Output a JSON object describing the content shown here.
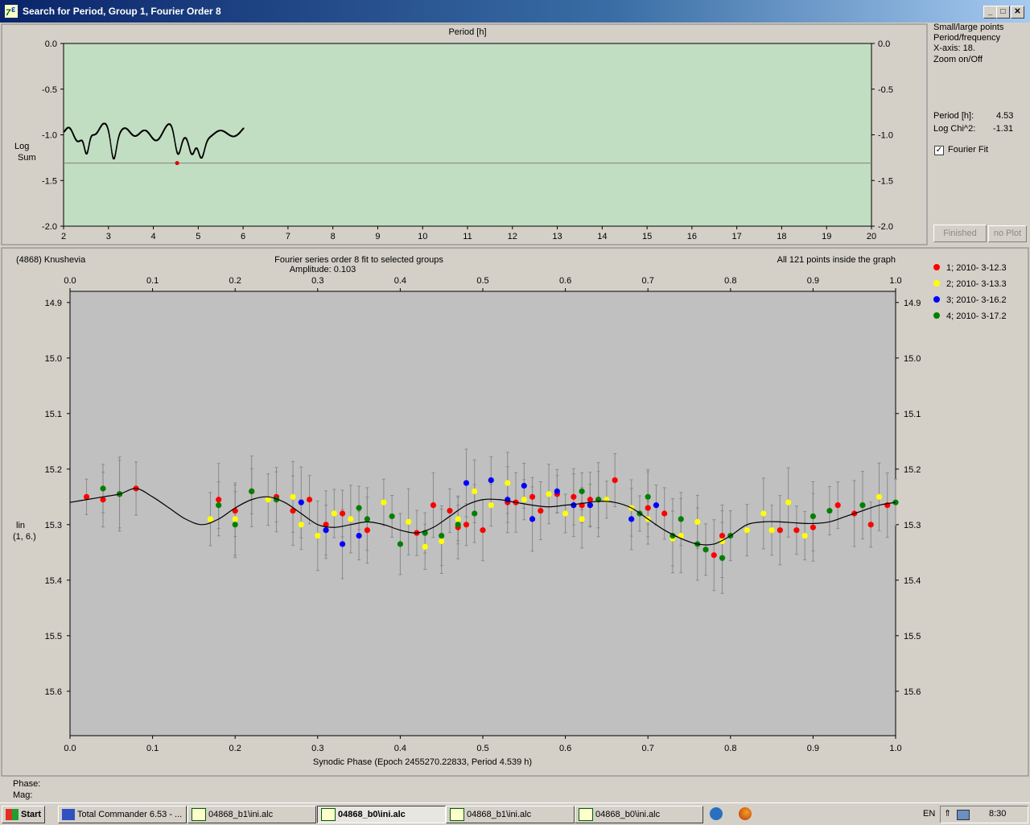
{
  "window": {
    "title": "Search for Period, Group 1, Fourier Order 8",
    "minimize_label": "_",
    "maximize_label": "□",
    "close_label": "✕"
  },
  "right_panel": {
    "options": [
      "Small/large points",
      "Period/frequency",
      "X-axis: 18.",
      "Zoom on/Off"
    ],
    "period_label": "Period [h]:",
    "period_value": "4.53",
    "logchi_label": "Log Chi^2:",
    "logchi_value": "-1.31",
    "fourier_fit_label": "Fourier Fit",
    "fourier_fit_checked": true,
    "finished_label": "Finished",
    "noplot_label": "no Plot"
  },
  "period_chart": {
    "title": "Period [h]",
    "ylabel_line1": "Log",
    "ylabel_line2": "Sum",
    "xticks": [
      "2",
      "3",
      "4",
      "5",
      "6",
      "7",
      "8",
      "9",
      "10",
      "11",
      "12",
      "13",
      "14",
      "15",
      "16",
      "17",
      "18",
      "19",
      "20"
    ],
    "yticks": [
      "0.0",
      "-0.5",
      "-1.0",
      "-1.5",
      "-2.0"
    ],
    "colors": {
      "background": "#c2dec2",
      "points": "#000000",
      "selected": "#e00000"
    }
  },
  "lightcurve_chart": {
    "object_name": "(4868) Knushevia",
    "title": "Fourier series order 8 fit to selected groups",
    "amplitude": "Amplitude: 0.103",
    "points_info": "All 121 points inside the graph",
    "ylabel_line1": "lin",
    "ylabel_line2": "(1, 6.)",
    "xlabel": "Synodic Phase (Epoch 2455270.22833, Period 4.539 h)",
    "xticks": [
      "0.0",
      "0.1",
      "0.2",
      "0.3",
      "0.4",
      "0.5",
      "0.6",
      "0.7",
      "0.8",
      "0.9",
      "1.0"
    ],
    "yticks": [
      "14.9",
      "15.0",
      "15.1",
      "15.2",
      "15.3",
      "15.4",
      "15.5",
      "15.6"
    ],
    "legend": [
      {
        "label": "1; 2010- 3-12.3",
        "color": "#ff0000"
      },
      {
        "label": "2; 2010- 3-13.3",
        "color": "#ffff00"
      },
      {
        "label": "3; 2010- 3-16.2",
        "color": "#0000ff"
      },
      {
        "label": "4; 2010- 3-17.2",
        "color": "#008000"
      }
    ]
  },
  "chart_data": [
    {
      "type": "scatter",
      "title": "Period [h]",
      "xlabel": "Period [h]",
      "ylabel": "Log Sum",
      "xlim": [
        2,
        20
      ],
      "ylim": [
        -2.0,
        0.0
      ],
      "minimum_marked": {
        "x": 4.53,
        "y": -1.31
      },
      "threshold_line": -1.31
    },
    {
      "type": "scatter",
      "title": "Fourier series order 8 fit to selected groups",
      "xlabel": "Synodic Phase (Epoch 2455270.22833, Period 4.539 h)",
      "ylabel": "lin (1, 6.)",
      "xlim": [
        0.0,
        1.0
      ],
      "ylim": [
        14.9,
        15.68
      ],
      "y_inverted": true,
      "fit_curve": {
        "x": [
          0.0,
          0.02,
          0.04,
          0.06,
          0.08,
          0.1,
          0.12,
          0.14,
          0.16,
          0.18,
          0.2,
          0.22,
          0.24,
          0.26,
          0.28,
          0.3,
          0.32,
          0.34,
          0.36,
          0.38,
          0.4,
          0.42,
          0.44,
          0.46,
          0.48,
          0.5,
          0.52,
          0.54,
          0.56,
          0.58,
          0.6,
          0.62,
          0.64,
          0.66,
          0.68,
          0.7,
          0.72,
          0.74,
          0.76,
          0.78,
          0.8,
          0.82,
          0.84,
          0.86,
          0.88,
          0.9,
          0.92,
          0.94,
          0.96,
          0.98,
          1.0
        ],
        "y": [
          15.26,
          15.255,
          15.25,
          15.245,
          15.235,
          15.25,
          15.27,
          15.29,
          15.3,
          15.29,
          15.27,
          15.255,
          15.25,
          15.26,
          15.28,
          15.3,
          15.305,
          15.3,
          15.295,
          15.3,
          15.31,
          15.315,
          15.305,
          15.285,
          15.265,
          15.255,
          15.255,
          15.26,
          15.265,
          15.268,
          15.265,
          15.262,
          15.258,
          15.26,
          15.27,
          15.29,
          15.31,
          15.325,
          15.335,
          15.335,
          15.32,
          15.3,
          15.295,
          15.295,
          15.297,
          15.298,
          15.295,
          15.285,
          15.275,
          15.265,
          15.26
        ]
      },
      "series": [
        {
          "name": "1; 2010- 3-12.3",
          "points": [
            [
              0.02,
              15.25
            ],
            [
              0.04,
              15.255
            ],
            [
              0.06,
              15.245
            ],
            [
              0.08,
              15.235
            ],
            [
              0.18,
              15.255
            ],
            [
              0.2,
              15.275
            ],
            [
              0.22,
              15.24
            ],
            [
              0.25,
              15.25
            ],
            [
              0.27,
              15.275
            ],
            [
              0.29,
              15.255
            ],
            [
              0.31,
              15.3
            ],
            [
              0.33,
              15.28
            ],
            [
              0.36,
              15.31
            ],
            [
              0.42,
              15.315
            ],
            [
              0.44,
              15.265
            ],
            [
              0.46,
              15.275
            ],
            [
              0.47,
              15.305
            ],
            [
              0.48,
              15.3
            ],
            [
              0.5,
              15.31
            ],
            [
              0.53,
              15.26
            ],
            [
              0.54,
              15.26
            ],
            [
              0.56,
              15.25
            ],
            [
              0.57,
              15.275
            ],
            [
              0.59,
              15.245
            ],
            [
              0.61,
              15.25
            ],
            [
              0.62,
              15.265
            ],
            [
              0.63,
              15.255
            ],
            [
              0.64,
              15.255
            ],
            [
              0.66,
              15.22
            ],
            [
              0.7,
              15.27
            ],
            [
              0.72,
              15.28
            ],
            [
              0.78,
              15.355
            ],
            [
              0.79,
              15.32
            ],
            [
              0.86,
              15.31
            ],
            [
              0.88,
              15.31
            ],
            [
              0.9,
              15.305
            ],
            [
              0.93,
              15.265
            ],
            [
              0.95,
              15.28
            ],
            [
              0.97,
              15.3
            ],
            [
              0.99,
              15.265
            ]
          ]
        },
        {
          "name": "2; 2010- 3-13.3",
          "points": [
            [
              0.17,
              15.29
            ],
            [
              0.2,
              15.29
            ],
            [
              0.24,
              15.255
            ],
            [
              0.27,
              15.25
            ],
            [
              0.28,
              15.3
            ],
            [
              0.3,
              15.32
            ],
            [
              0.32,
              15.28
            ],
            [
              0.34,
              15.29
            ],
            [
              0.38,
              15.26
            ],
            [
              0.41,
              15.295
            ],
            [
              0.43,
              15.34
            ],
            [
              0.45,
              15.33
            ],
            [
              0.47,
              15.29
            ],
            [
              0.49,
              15.24
            ],
            [
              0.51,
              15.265
            ],
            [
              0.53,
              15.225
            ],
            [
              0.55,
              15.255
            ],
            [
              0.58,
              15.245
            ],
            [
              0.6,
              15.28
            ],
            [
              0.62,
              15.29
            ],
            [
              0.65,
              15.255
            ],
            [
              0.68,
              15.27
            ],
            [
              0.7,
              15.29
            ],
            [
              0.73,
              15.325
            ],
            [
              0.74,
              15.32
            ],
            [
              0.76,
              15.295
            ],
            [
              0.79,
              15.33
            ],
            [
              0.82,
              15.31
            ],
            [
              0.84,
              15.28
            ],
            [
              0.85,
              15.31
            ],
            [
              0.87,
              15.26
            ],
            [
              0.89,
              15.32
            ],
            [
              0.98,
              15.25
            ]
          ]
        },
        {
          "name": "3; 2010- 3-16.2",
          "points": [
            [
              0.28,
              15.26
            ],
            [
              0.31,
              15.31
            ],
            [
              0.33,
              15.335
            ],
            [
              0.35,
              15.32
            ],
            [
              0.48,
              15.225
            ],
            [
              0.51,
              15.22
            ],
            [
              0.53,
              15.255
            ],
            [
              0.55,
              15.23
            ],
            [
              0.56,
              15.29
            ],
            [
              0.59,
              15.24
            ],
            [
              0.61,
              15.265
            ],
            [
              0.63,
              15.265
            ],
            [
              0.68,
              15.29
            ],
            [
              0.71,
              15.265
            ]
          ]
        },
        {
          "name": "4; 2010- 3-17.2",
          "points": [
            [
              0.04,
              15.235
            ],
            [
              0.06,
              15.245
            ],
            [
              0.18,
              15.265
            ],
            [
              0.2,
              15.3
            ],
            [
              0.22,
              15.24
            ],
            [
              0.25,
              15.255
            ],
            [
              0.35,
              15.27
            ],
            [
              0.36,
              15.29
            ],
            [
              0.39,
              15.285
            ],
            [
              0.4,
              15.335
            ],
            [
              0.43,
              15.315
            ],
            [
              0.45,
              15.32
            ],
            [
              0.47,
              15.3
            ],
            [
              0.49,
              15.28
            ],
            [
              0.62,
              15.24
            ],
            [
              0.64,
              15.255
            ],
            [
              0.69,
              15.28
            ],
            [
              0.7,
              15.25
            ],
            [
              0.73,
              15.32
            ],
            [
              0.74,
              15.29
            ],
            [
              0.76,
              15.335
            ],
            [
              0.77,
              15.345
            ],
            [
              0.79,
              15.36
            ],
            [
              0.8,
              15.32
            ],
            [
              0.9,
              15.285
            ],
            [
              0.92,
              15.275
            ],
            [
              0.96,
              15.265
            ],
            [
              1.0,
              15.26
            ]
          ]
        }
      ]
    }
  ],
  "bottom_labels": {
    "phase": "Phase:",
    "mag": "Mag:"
  },
  "taskbar": {
    "start_label": "Start",
    "tasks": [
      {
        "label": "Total Commander 6.53 - ...",
        "active": false
      },
      {
        "label": "04868_b1\\ini.alc",
        "active": false
      },
      {
        "label": "04868_b0\\ini.alc",
        "active": true
      },
      {
        "label": "04868_b1\\ini.alc",
        "active": false
      },
      {
        "label": "04868_b0\\ini.alc",
        "active": false
      }
    ],
    "language": "EN",
    "time": "8:30"
  }
}
